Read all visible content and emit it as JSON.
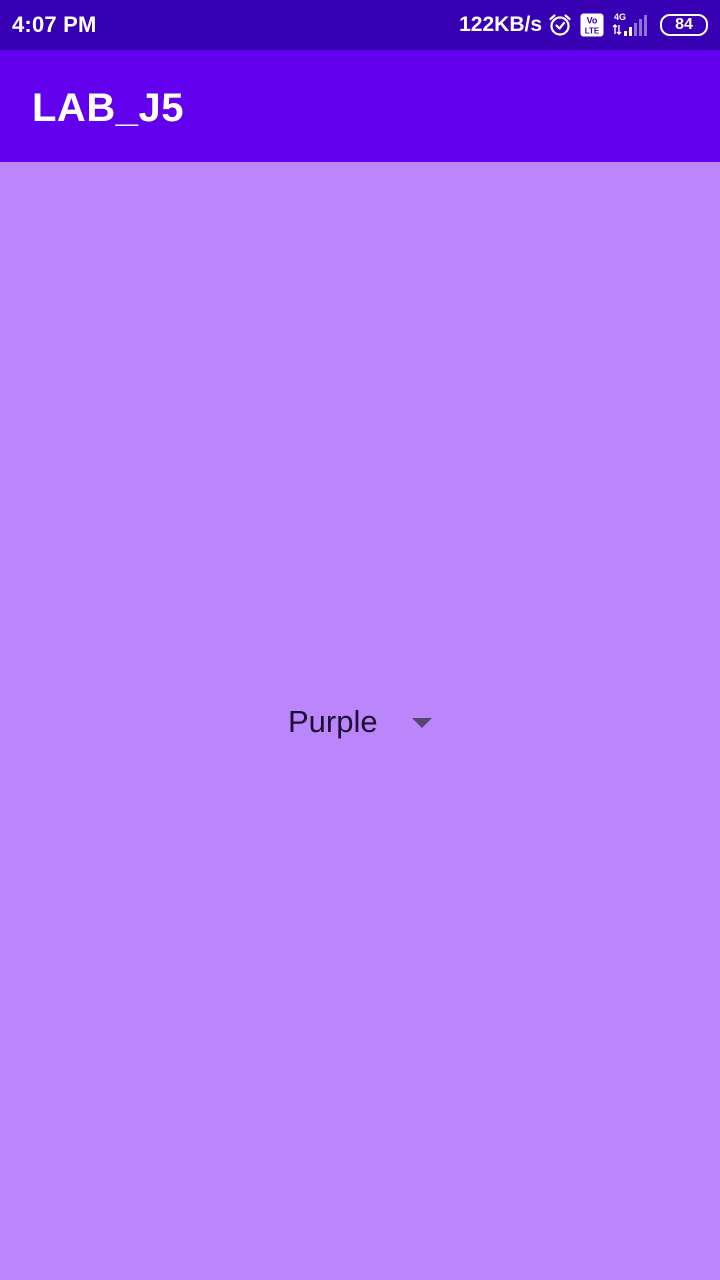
{
  "status_bar": {
    "time": "4:07 PM",
    "network_speed": "122KB/s",
    "network_type": "4G",
    "volte_top": "Vo",
    "volte_bottom": "LTE",
    "battery_level": "84",
    "icons": [
      "alarm-icon",
      "volte-icon",
      "signal-icon",
      "battery-icon"
    ]
  },
  "app_bar": {
    "title": "LAB_J5"
  },
  "spinner": {
    "selected_value": "Purple"
  },
  "colors": {
    "status_bar": "#3700B3",
    "app_bar": "#6200EE",
    "background": "#BB86FC"
  }
}
